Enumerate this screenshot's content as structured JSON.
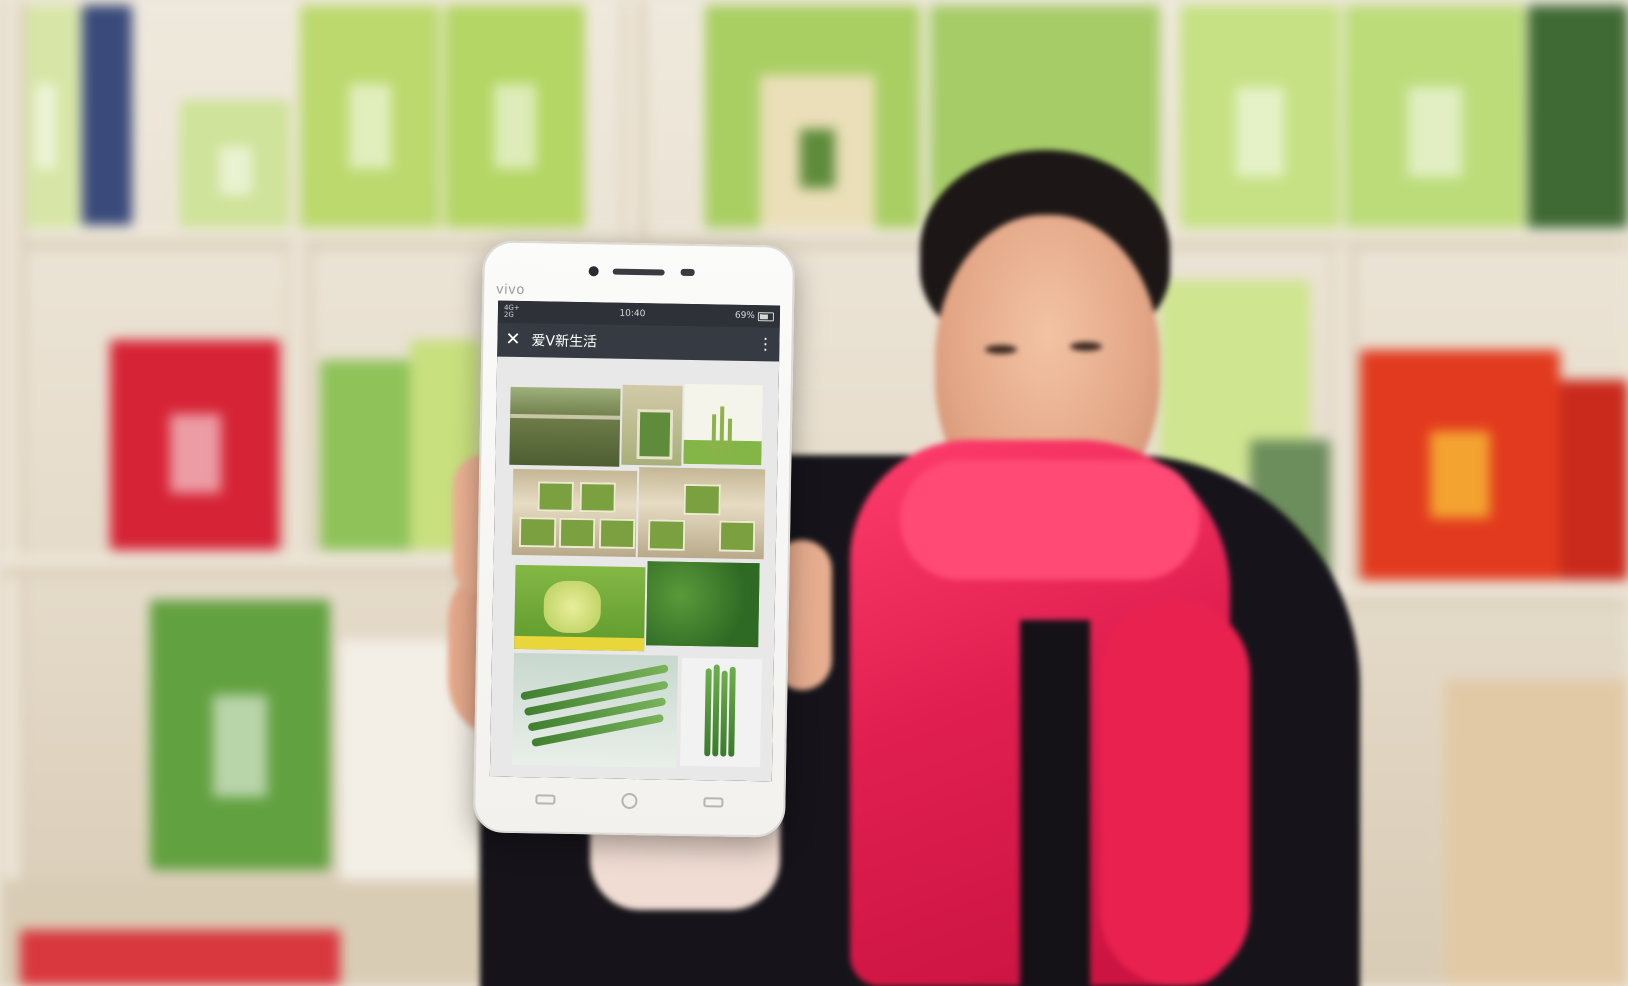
{
  "phone": {
    "brand": "vivo",
    "status": {
      "network_top": "4G+",
      "network_bottom": "2G",
      "time": "10:40",
      "battery": "69%"
    },
    "app_title": "爱V新生活",
    "icons": {
      "close": "close-icon",
      "more": "more-vertical-icon",
      "battery": "battery-icon"
    },
    "gallery": [
      {
        "name": "asparagus-field"
      },
      {
        "name": "tea-package"
      },
      {
        "name": "asparagus-tea-package"
      },
      {
        "name": "product-shelf-display"
      },
      {
        "name": "product-boxes"
      },
      {
        "name": "product-poster"
      },
      {
        "name": "fresh-greens"
      },
      {
        "name": "asparagus-bundle"
      },
      {
        "name": "asparagus-stalks"
      }
    ]
  }
}
